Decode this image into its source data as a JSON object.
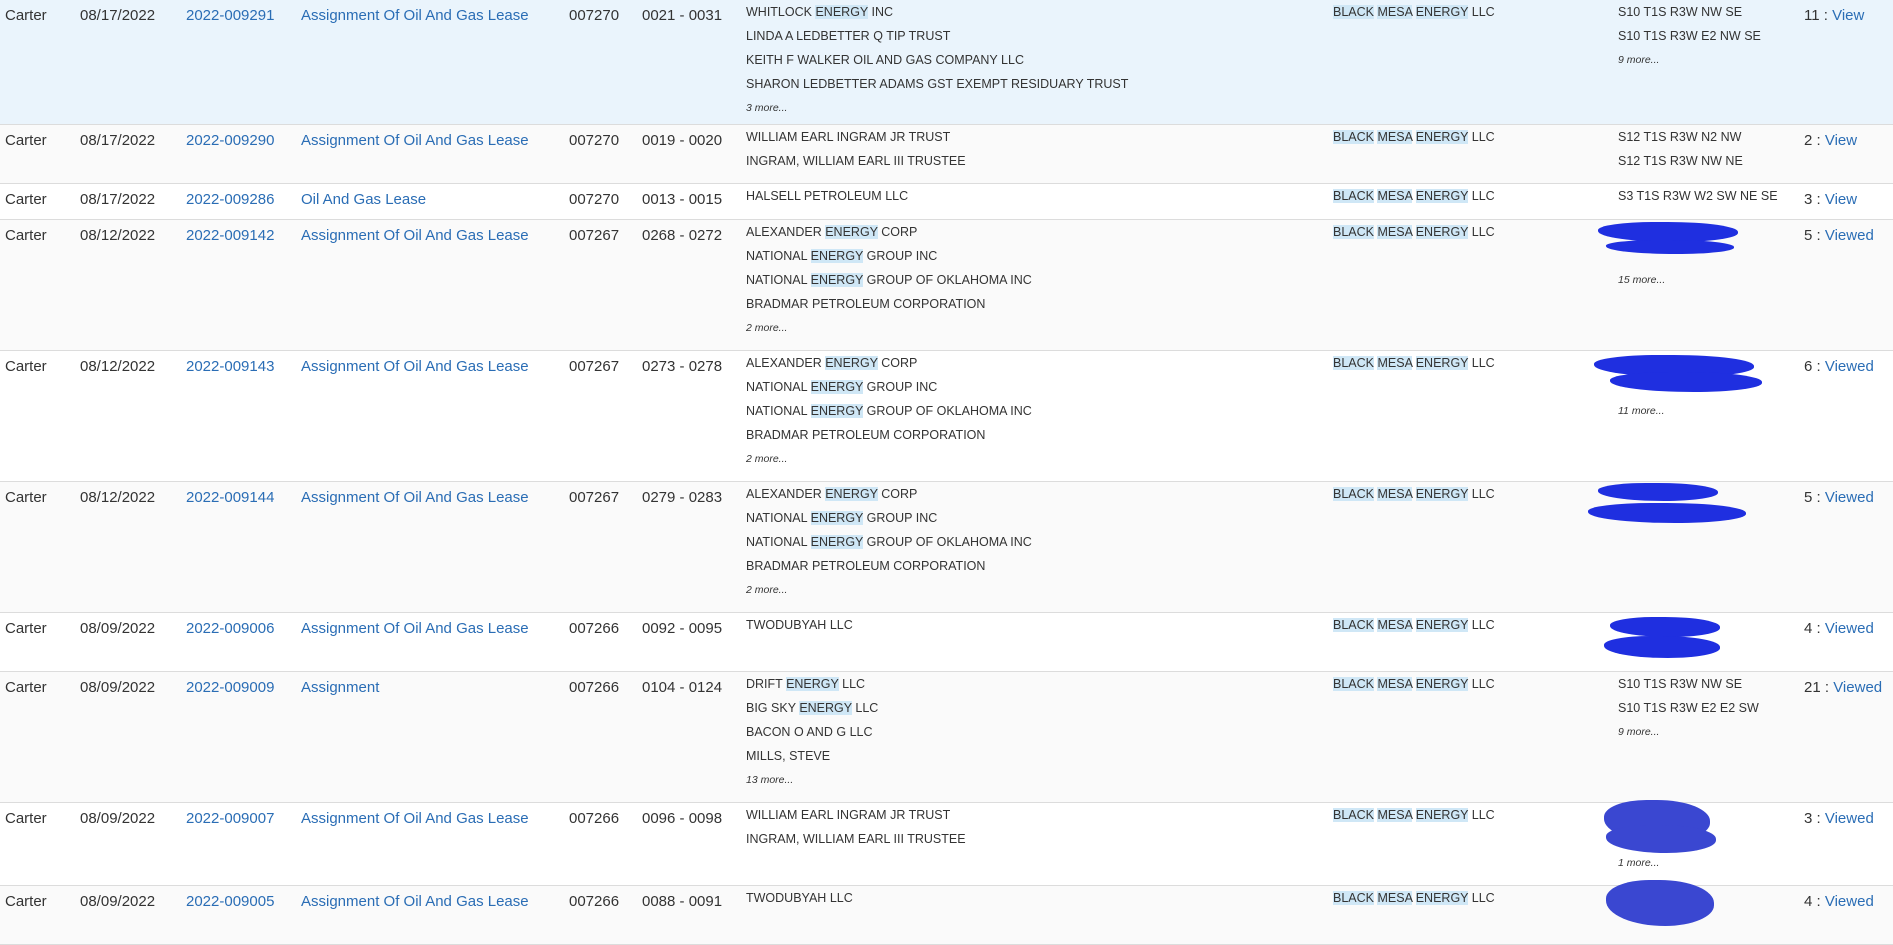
{
  "rows": [
    {
      "county": "Carter",
      "date": "08/17/2022",
      "instrument": "2022-009291",
      "type": "Assignment Of Oil And Gas Lease",
      "book": "007270",
      "pages": "0021 - 0031",
      "grantors": [
        "WHITLOCK ENERGY INC",
        "LINDA A LEDBETTER Q TIP TRUST",
        "KEITH F WALKER OIL AND GAS COMPANY LLC",
        "SHARON LEDBETTER ADAMS GST EXEMPT RESIDUARY TRUST"
      ],
      "grantors_more": "3 more...",
      "grantee": "BLACK MESA ENERGY LLC",
      "legal": [
        "S10 T1S R3W NW SE",
        "S10 T1S R3W E2 NW SE"
      ],
      "legal_more": "9 more...",
      "count": "11",
      "view": "View"
    },
    {
      "county": "Carter",
      "date": "08/17/2022",
      "instrument": "2022-009290",
      "type": "Assignment Of Oil And Gas Lease",
      "book": "007270",
      "pages": "0019 - 0020",
      "grantors": [
        "WILLIAM EARL INGRAM JR TRUST",
        "INGRAM, WILLIAM EARL III TRUSTEE"
      ],
      "grantors_more": "",
      "grantee": "BLACK MESA ENERGY LLC",
      "legal": [
        "S12 T1S R3W N2 NW",
        "S12 T1S R3W NW NE"
      ],
      "legal_more": "",
      "count": "2",
      "view": "View"
    },
    {
      "county": "Carter",
      "date": "08/17/2022",
      "instrument": "2022-009286",
      "type": "Oil And Gas Lease",
      "book": "007270",
      "pages": "0013 - 0015",
      "grantors": [
        "HALSELL PETROLEUM LLC"
      ],
      "grantors_more": "",
      "grantee": "BLACK MESA ENERGY LLC",
      "legal": [
        "S3 T1S R3W W2 SW NE SE"
      ],
      "legal_more": "",
      "count": "3",
      "view": "View"
    },
    {
      "county": "Carter",
      "date": "08/12/2022",
      "instrument": "2022-009142",
      "type": "Assignment Of Oil And Gas Lease",
      "book": "007267",
      "pages": "0268 - 0272",
      "grantors": [
        "ALEXANDER ENERGY CORP",
        "NATIONAL ENERGY GROUP INC",
        "NATIONAL ENERGY GROUP OF OKLAHOMA INC",
        "BRADMAR PETROLEUM CORPORATION"
      ],
      "grantors_more": "2 more...",
      "grantee": "BLACK MESA ENERGY LLC",
      "legal": [],
      "legal_more": "15 more...",
      "count": "5",
      "view": "Viewed"
    },
    {
      "county": "Carter",
      "date": "08/12/2022",
      "instrument": "2022-009143",
      "type": "Assignment Of Oil And Gas Lease",
      "book": "007267",
      "pages": "0273 - 0278",
      "grantors": [
        "ALEXANDER ENERGY CORP",
        "NATIONAL ENERGY GROUP INC",
        "NATIONAL ENERGY GROUP OF OKLAHOMA INC",
        "BRADMAR PETROLEUM CORPORATION"
      ],
      "grantors_more": "2 more...",
      "grantee": "BLACK MESA ENERGY LLC",
      "legal": [],
      "legal_more": "11 more...",
      "count": "6",
      "view": "Viewed"
    },
    {
      "county": "Carter",
      "date": "08/12/2022",
      "instrument": "2022-009144",
      "type": "Assignment Of Oil And Gas Lease",
      "book": "007267",
      "pages": "0279 - 0283",
      "grantors": [
        "ALEXANDER ENERGY CORP",
        "NATIONAL ENERGY GROUP INC",
        "NATIONAL ENERGY GROUP OF OKLAHOMA INC",
        "BRADMAR PETROLEUM CORPORATION"
      ],
      "grantors_more": "2 more...",
      "grantee": "BLACK MESA ENERGY LLC",
      "legal": [],
      "legal_more": "",
      "count": "5",
      "view": "Viewed"
    },
    {
      "county": "Carter",
      "date": "08/09/2022",
      "instrument": "2022-009006",
      "type": "Assignment Of Oil And Gas Lease",
      "book": "007266",
      "pages": "0092 - 0095",
      "grantors": [
        "TWODUBYAH LLC"
      ],
      "grantors_more": "",
      "grantee": "BLACK MESA ENERGY LLC",
      "legal": [],
      "legal_more": "",
      "count": "4",
      "view": "Viewed"
    },
    {
      "county": "Carter",
      "date": "08/09/2022",
      "instrument": "2022-009009",
      "type": "Assignment",
      "book": "007266",
      "pages": "0104 - 0124",
      "grantors": [
        "DRIFT ENERGY LLC",
        "BIG SKY ENERGY LLC",
        "BACON O AND G LLC",
        "MILLS, STEVE"
      ],
      "grantors_more": "13 more...",
      "grantee": "BLACK MESA ENERGY LLC",
      "legal": [
        "S10 T1S R3W NW SE",
        "S10 T1S R3W E2 E2 SW"
      ],
      "legal_more": "9 more...",
      "count": "21",
      "view": "Viewed"
    },
    {
      "county": "Carter",
      "date": "08/09/2022",
      "instrument": "2022-009007",
      "type": "Assignment Of Oil And Gas Lease",
      "book": "007266",
      "pages": "0096 - 0098",
      "grantors": [
        "WILLIAM EARL INGRAM JR TRUST",
        "INGRAM, WILLIAM EARL III TRUSTEE"
      ],
      "grantors_more": "",
      "grantee": "BLACK MESA ENERGY LLC",
      "legal": [],
      "legal_more": "1 more...",
      "count": "3",
      "view": "Viewed"
    },
    {
      "county": "Carter",
      "date": "08/09/2022",
      "instrument": "2022-009005",
      "type": "Assignment Of Oil And Gas Lease",
      "book": "007266",
      "pages": "0088 - 0091",
      "grantors": [
        "TWODUBYAH LLC"
      ],
      "grantors_more": "",
      "grantee": "BLACK MESA ENERGY LLC",
      "legal": [],
      "legal_more": "",
      "count": "4",
      "view": "Viewed"
    }
  ],
  "highlight_terms": [
    "ENERGY",
    "BLACK",
    "MESA"
  ],
  "colors": {
    "link": "#2a6db5",
    "highlight": "#cfe7f6",
    "redaction": "#1f2fe0",
    "row_selected": "#eaf4fc"
  }
}
